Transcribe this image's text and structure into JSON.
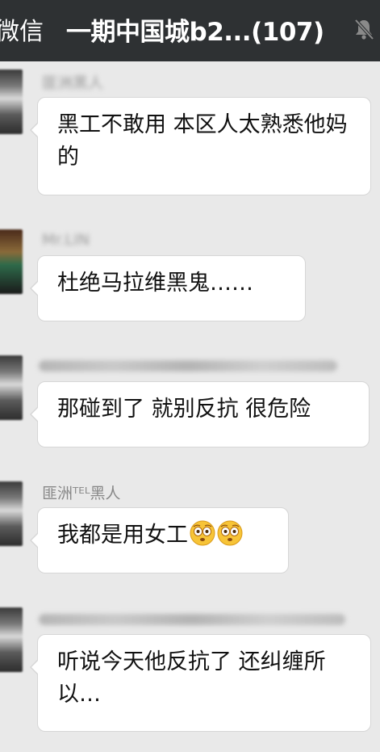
{
  "header": {
    "back_label": "微信",
    "title": "一期中国城b2...(107)",
    "mute_icon": "bell-muted-icon"
  },
  "messages": [
    {
      "sender": "匪洲黑人",
      "sender_visible": false,
      "text": "黑工不敢用 本区人太熟悉他妈的"
    },
    {
      "sender": "Mr.LIN",
      "sender_visible": false,
      "text": "杜绝马拉维黑鬼……"
    },
    {
      "sender": "",
      "sender_visible": false,
      "text": "那碰到了 就别反抗 很危险"
    },
    {
      "sender": "匪洲ᵀᴱᴸ黑人",
      "sender_visible": true,
      "text": "我都是用女工",
      "emoji": [
        "flushed-face-icon",
        "flushed-face-icon"
      ]
    },
    {
      "sender": "",
      "sender_visible": false,
      "text": "听说今天他反抗了 还纠缠所以…"
    }
  ],
  "colors": {
    "topbar_bg": "#2e3133",
    "chat_bg": "#e9e9e9",
    "bubble_bg": "#ffffff",
    "sender_text": "#888888"
  }
}
